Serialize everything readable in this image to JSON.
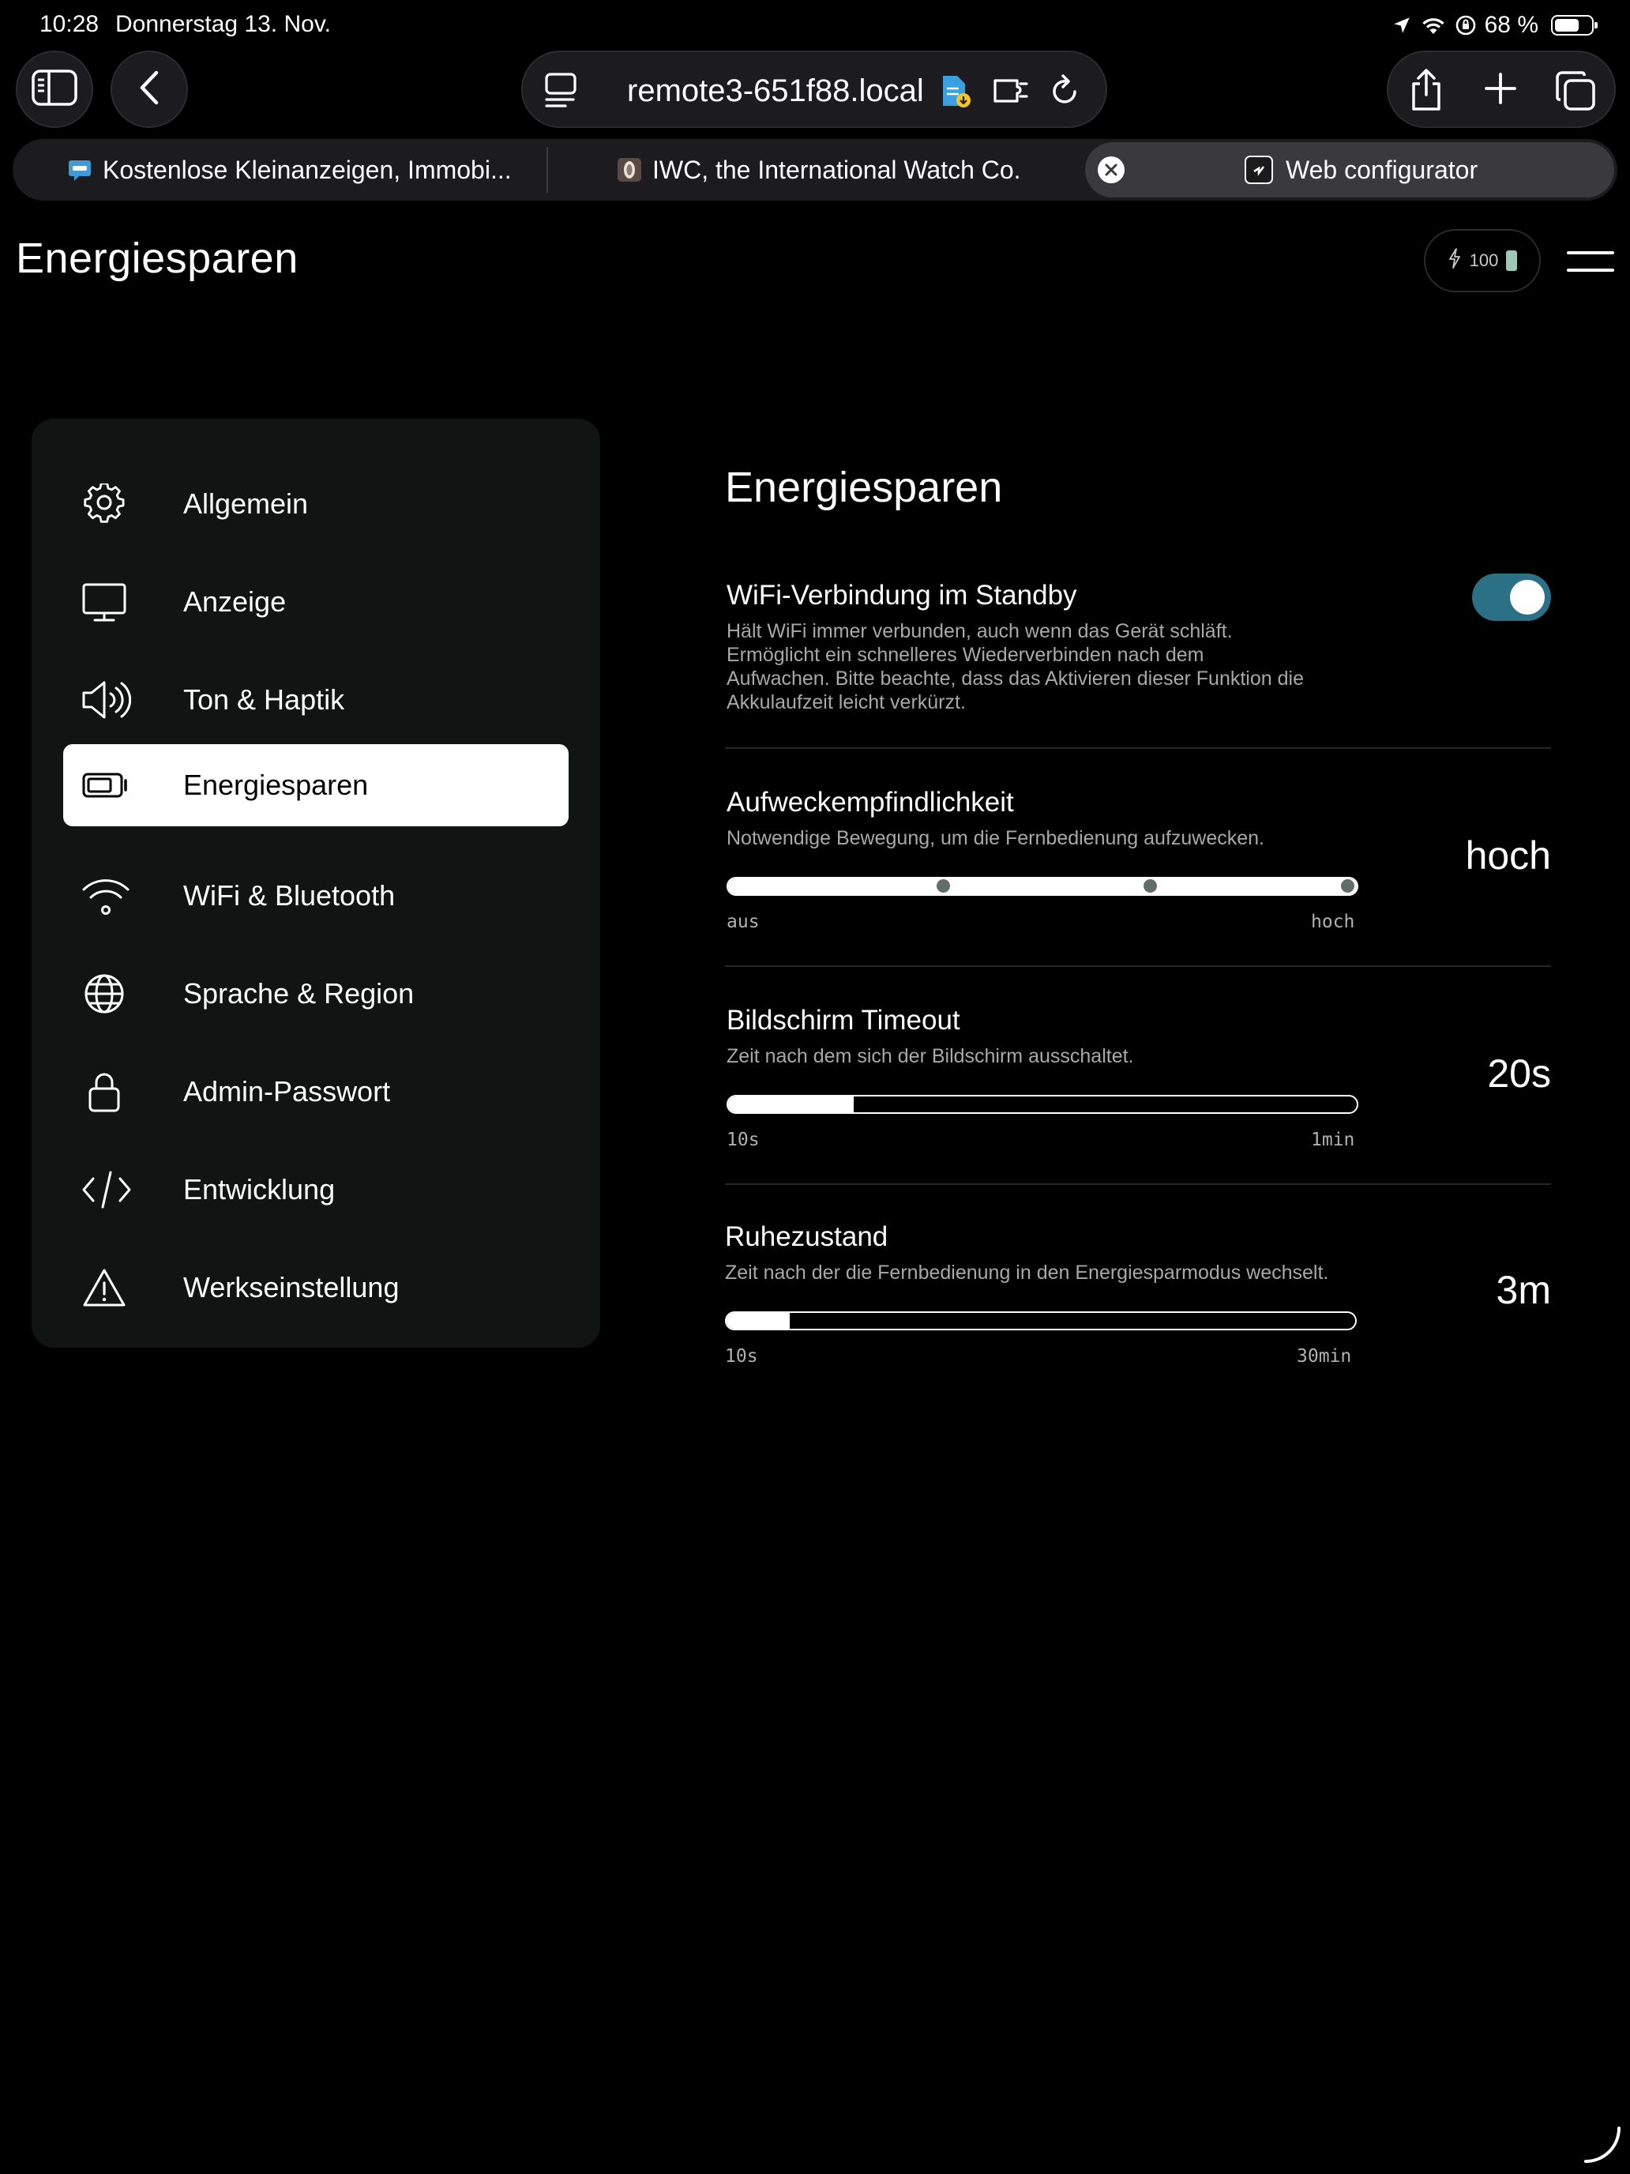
{
  "status_bar": {
    "time": "10:28",
    "date": "Donnerstag 13. Nov.",
    "battery_percent": "68 %",
    "battery_level": 0.68
  },
  "browser": {
    "url": "remote3-651f88.local",
    "tabs": [
      {
        "title": "Kostenlose Kleinanzeigen, Immobi...",
        "active": false
      },
      {
        "title": "IWC, the International Watch Co.",
        "active": false
      },
      {
        "title": "Web configurator",
        "active": true
      }
    ]
  },
  "header": {
    "title": "Energiesparen",
    "battery_label": "100",
    "battery_color": "#9fc7b8"
  },
  "menu": {
    "items": [
      {
        "label": "Allgemein",
        "icon": "gear-icon",
        "active": false
      },
      {
        "label": "Anzeige",
        "icon": "monitor-icon",
        "active": false
      },
      {
        "label": "Ton & Haptik",
        "icon": "speaker-icon",
        "active": false
      },
      {
        "label": "Energiesparen",
        "icon": "battery-icon",
        "active": true
      },
      {
        "label": "WiFi & Bluetooth",
        "icon": "wifi-icon",
        "active": false
      },
      {
        "label": "Sprache & Region",
        "icon": "globe-icon",
        "active": false
      },
      {
        "label": "Admin-Passwort",
        "icon": "lock-icon",
        "active": false
      },
      {
        "label": "Entwicklung",
        "icon": "code-icon",
        "active": false
      },
      {
        "label": "Werkseinstellung",
        "icon": "warning-icon",
        "active": false
      }
    ]
  },
  "content": {
    "title": "Energiesparen",
    "accent_color": "#2b7085",
    "wifi_standby": {
      "title": "WiFi-Verbindung im Standby",
      "desc_1": "Hält WiFi immer verbunden, auch wenn das Gerät schläft.",
      "desc_2": "Ermöglicht ein schnelleres Wiederverbinden nach dem",
      "desc_3": "Aufwachen. Bitte beachte, dass das Aktivieren dieser Funktion die",
      "desc_4": "Akkulaufzeit leicht verkürzt.",
      "enabled": true
    },
    "wake_sensitivity": {
      "title": "Aufweckempfindlichkeit",
      "desc": "Notwendige Bewegung, um die Fernbedienung aufzuwecken.",
      "value": "hoch",
      "level": 1.0,
      "min_label": "aus",
      "max_label": "hoch"
    },
    "screen_timeout": {
      "title": "Bildschirm Timeout",
      "desc": "Zeit nach dem sich der Bildschirm ausschaltet.",
      "value": "20s",
      "level": 0.2,
      "min_label": "10s",
      "max_label": "1min"
    },
    "sleep": {
      "title": "Ruhezustand",
      "desc": "Zeit nach der die Fernbedienung in den Energiesparmodus wechselt.",
      "value": "3m",
      "level": 0.1,
      "min_label": "10s",
      "max_label": "30min"
    }
  }
}
